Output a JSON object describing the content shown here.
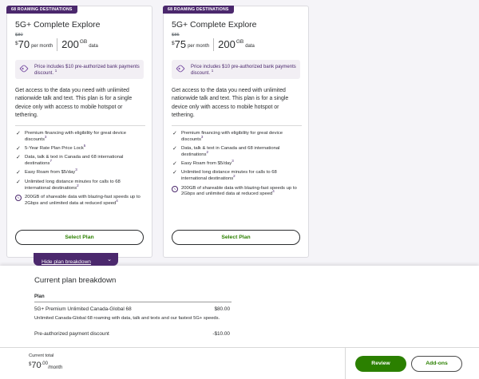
{
  "plans": [
    {
      "badge": "68 ROAMING DESTINATIONS",
      "title": "5G+ Complete Explore",
      "old_price": "$80",
      "currency": "$",
      "price": "70",
      "per_month": "per month",
      "data_amount": "200",
      "data_unit": "GB",
      "data_label": "data",
      "promo": "Price includes $10 pre-authorized bank payments discount.",
      "promo_sup": "1",
      "description": "Get access to the data you need with unlimited nationwide talk and text. This plan is for a single device only with access to mobile hotspot or tethering.",
      "features": [
        {
          "text": "Premium financing with eligibility for great device discounts",
          "sup": "3",
          "icon": "checkmark-icon"
        },
        {
          "text": "5-Year Rate Plan Price Lock",
          "sup": "5",
          "icon": "checkmark-icon"
        },
        {
          "text": "Data, talk & text in Canada and 68 international destinations",
          "sup": "7",
          "icon": "checkmark-icon"
        },
        {
          "text": "Easy Roam from $5/day",
          "sup": "3",
          "icon": "checkmark-icon"
        },
        {
          "text": "Unlimited long distance minutes for calls to 68 international destinations",
          "sup": "2",
          "icon": "checkmark-icon"
        },
        {
          "text": "200GB of shareable data with blazing-fast speeds up to 2Gbps and unlimited data at reduced speed",
          "sup": "4",
          "icon": "signal-wave-icon"
        }
      ],
      "select_label": "Select Plan"
    },
    {
      "badge": "68 ROAMING DESTINATIONS",
      "title": "5G+ Complete Explore",
      "old_price": "$85",
      "currency": "$",
      "price": "75",
      "per_month": "per month",
      "data_amount": "200",
      "data_unit": "GB",
      "data_label": "data",
      "promo": "Price includes $10 pre-authorized bank payments discount.",
      "promo_sup": "1",
      "description": "Get access to the data you need with unlimited nationwide talk and text. This plan is for a single device only with access to mobile hotspot or tethering.",
      "features": [
        {
          "text": "Premium financing with eligibility for great device discounts",
          "sup": "3",
          "icon": "checkmark-icon"
        },
        {
          "text": "Data, talk & text in Canada and 68 international destinations",
          "sup": "2",
          "icon": "checkmark-icon"
        },
        {
          "text": "Easy Roam from $5/day",
          "sup": "3",
          "icon": "checkmark-icon"
        },
        {
          "text": "Unlimited long distance minutes for calls to 68 international destinations",
          "sup": "2",
          "icon": "checkmark-icon"
        },
        {
          "text": "200GB of shareable data with blazing-fast speeds up to 2Gbps and unlimited data at reduced speed",
          "sup": "4",
          "icon": "signal-wave-icon"
        }
      ],
      "select_label": "Select Plan"
    }
  ],
  "hide_breakdown_label": "Hide plan breakdown",
  "breakdown": {
    "title": "Current plan breakdown",
    "header": "Plan",
    "items": [
      {
        "name": "5G+ Premium Unlimited Canada-Global 68",
        "amount": "$80.00",
        "detail": "Unlimited Canada-Global 68 roaming with data, talk and texts and our fastest 5G+ speeds."
      },
      {
        "name": "Pre-authorized payment discount",
        "amount": "-$10.00",
        "detail": ""
      }
    ]
  },
  "footer": {
    "total_label": "Current total",
    "currency": "$",
    "total_whole": "70",
    "total_decimal": ".00",
    "total_per": "/month",
    "review_label": "Review",
    "addons_label": "Add-ons"
  },
  "colors": {
    "brand_purple": "#4b286d",
    "accent_green": "#2b8000"
  }
}
